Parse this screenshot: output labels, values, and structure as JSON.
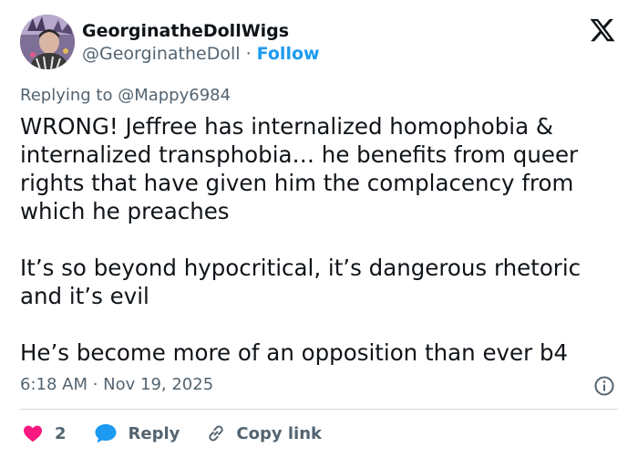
{
  "tweet": {
    "author": {
      "display_name": "GeorginatheDollWigs",
      "handle": "@GeorginatheDoll",
      "separator": " · ",
      "follow_label": "Follow",
      "avatar_icon": "avatar-photo"
    },
    "replying_to": "Replying to @Mappy6984",
    "paragraphs": [
      "WRONG! Jeffree has internalized homophobia & internalized transphobia… he benefits from queer rights that have given him the complacency from which he preaches",
      "It’s so beyond hypocritical, it’s dangerous rhetoric and it’s evil",
      "He’s become more of an opposition than ever b4"
    ],
    "timestamp": "6:18 AM · Nov 19, 2025",
    "actions": {
      "like_count": "2",
      "reply_label": "Reply",
      "copy_link_label": "Copy link"
    }
  },
  "icons": {
    "logo": "x-logo-icon",
    "info": "info-icon",
    "like": "heart-icon",
    "reply": "speech-bubble-icon",
    "copy": "link-icon"
  },
  "colors": {
    "text_primary": "#0f1419",
    "text_secondary": "#536471",
    "accent_blue": "#1d9bf0",
    "like_pink": "#f91880",
    "divider": "#cfd9de"
  }
}
